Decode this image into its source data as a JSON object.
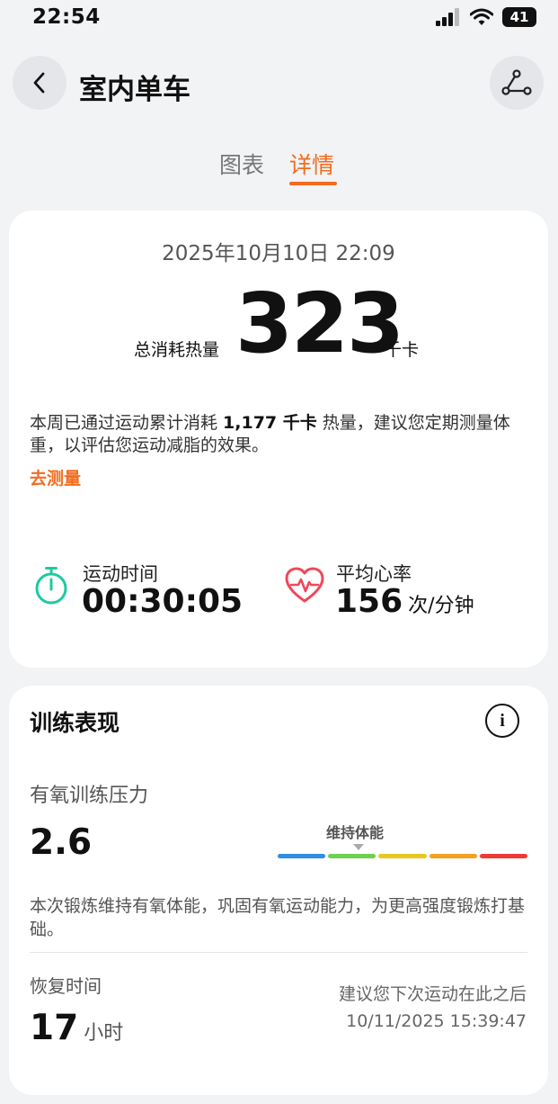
{
  "status_bar": {
    "time": "22:54",
    "battery": "41"
  },
  "header": {
    "title": "室内单车",
    "back_icon": "back-icon",
    "route_icon": "route-icon"
  },
  "tabs": [
    {
      "label": "图表",
      "active": false
    },
    {
      "label": "详情",
      "active": true
    }
  ],
  "summary": {
    "datetime": "2025年10月10日 22:09",
    "calories_label": "总消耗热量",
    "calories_value": "323",
    "calories_unit": "千卡",
    "weekly_prefix": "本周已通过运动累计消耗 ",
    "weekly_value": "1,177 千卡",
    "weekly_suffix": " 热量，建议您定期测量体重，以评估您运动减脂的效果。",
    "measure_link": "去测量",
    "duration_label": "运动时间",
    "duration_value": "00:30:05",
    "hr_label": "平均心率",
    "hr_value": "156",
    "hr_unit": "次/分钟"
  },
  "training": {
    "title": "训练表现",
    "aerobic_label": "有氧训练压力",
    "aerobic_value": "2.6",
    "gauge_label": "维持体能",
    "gauge_colors": [
      "#2f8de4",
      "#6dd04e",
      "#e8c820",
      "#f5a024",
      "#ee3a35"
    ],
    "description": "本次锻炼维持有氧体能，巩固有氧运动能力，为更高强度锻炼打基础。",
    "recovery_label": "恢复时间",
    "recovery_value": "17",
    "recovery_unit": "小时",
    "suggest_text": "建议您下次运动在此之后",
    "suggest_time": "10/11/2025 15:39:47"
  },
  "colors": {
    "accent": "#f26c1f",
    "timer_icon": "#1fc8a2",
    "heart_icon": "#f0485a"
  }
}
